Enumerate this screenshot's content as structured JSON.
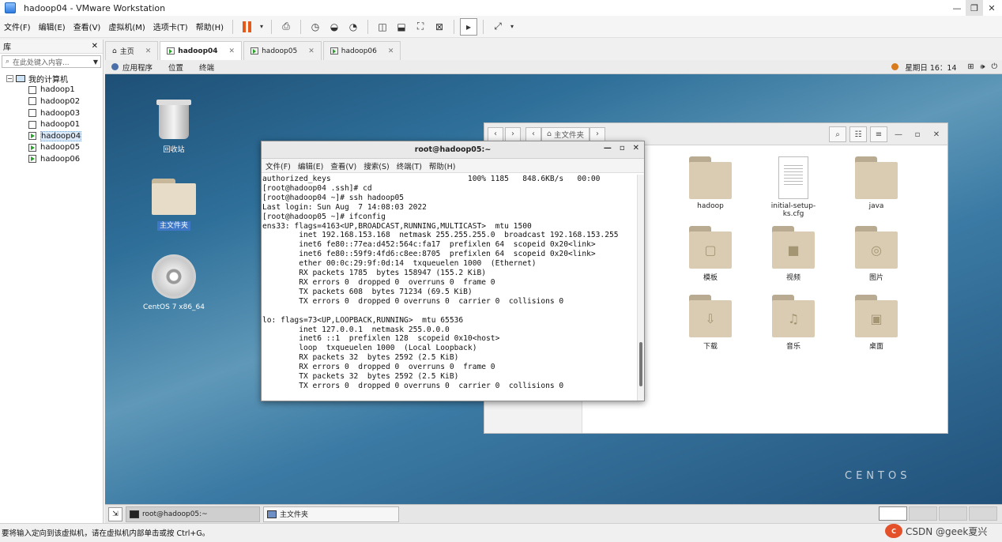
{
  "window": {
    "title": "hadoop04 - VMware Workstation",
    "min": "—",
    "max": "❐",
    "close": "✕"
  },
  "menu": {
    "items": [
      "文件(F)",
      "编辑(E)",
      "查看(V)",
      "虚拟机(M)",
      "选项卡(T)",
      "帮助(H)"
    ]
  },
  "library": {
    "title": "库",
    "close": "✕",
    "search_placeholder": "在此处键入内容...",
    "root": "我的计算机",
    "vms": [
      {
        "name": "hadoop1",
        "running": false
      },
      {
        "name": "hadoop02",
        "running": false
      },
      {
        "name": "hadoop03",
        "running": false
      },
      {
        "name": "hadoop01",
        "running": false
      },
      {
        "name": "hadoop04",
        "running": true,
        "selected": true
      },
      {
        "name": "hadoop05",
        "running": true
      },
      {
        "name": "hadoop06",
        "running": true
      }
    ]
  },
  "tabs": [
    {
      "label": "主页",
      "active": false
    },
    {
      "label": "hadoop04",
      "active": true
    },
    {
      "label": "hadoop05",
      "active": false
    },
    {
      "label": "hadoop06",
      "active": false
    }
  ],
  "guest": {
    "topbar": {
      "apps": "应用程序",
      "places": "位置",
      "terminal": "终端",
      "clock": "星期日 16：14"
    },
    "desktop": {
      "trash": "回收站",
      "home": "主文件夹",
      "disc": "CentOS 7 x86_64",
      "brand": "CENTOS"
    },
    "filemanager": {
      "path": "主文件夹",
      "items": [
        {
          "name": "cfg",
          "kind": "partial"
        },
        {
          "name": "hadoop",
          "kind": "folder",
          "glyph": ""
        },
        {
          "name": "initial-setup-ks.cfg",
          "kind": "doc"
        },
        {
          "name": "java",
          "kind": "folder",
          "glyph": ""
        },
        {
          "name": "模板",
          "kind": "folder",
          "glyph": "▢"
        },
        {
          "name": "视频",
          "kind": "folder",
          "glyph": "■"
        },
        {
          "name": "图片",
          "kind": "folder",
          "glyph": "◎"
        },
        {
          "name": "下载",
          "kind": "folder",
          "glyph": "⇩"
        },
        {
          "name": "音乐",
          "kind": "folder",
          "glyph": "♫"
        },
        {
          "name": "桌面",
          "kind": "folder",
          "glyph": "▣"
        }
      ]
    },
    "terminal": {
      "title": "root@hadoop05:~",
      "menu": [
        "文件(F)",
        "编辑(E)",
        "查看(V)",
        "搜索(S)",
        "终端(T)",
        "帮助(H)"
      ],
      "lines": [
        "authorized_keys                              100% 1185   848.6KB/s   00:00",
        "[root@hadoop04 .ssh]# cd",
        "[root@hadoop04 ~]# ssh hadoop05",
        "Last login: Sun Aug  7 14:08:03 2022",
        "[root@hadoop05 ~]# ifconfig",
        "ens33: flags=4163<UP,BROADCAST,RUNNING,MULTICAST>  mtu 1500",
        "        inet 192.168.153.168  netmask 255.255.255.0  broadcast 192.168.153.255",
        "        inet6 fe80::77ea:d452:564c:fa17  prefixlen 64  scopeid 0x20<link>",
        "        inet6 fe80::59f9:4fd6:c8ee:8705  prefixlen 64  scopeid 0x20<link>",
        "        ether 00:0c:29:9f:0d:14  txqueuelen 1000  (Ethernet)",
        "        RX packets 1785  bytes 158947 (155.2 KiB)",
        "        RX errors 0  dropped 0  overruns 0  frame 0",
        "        TX packets 608  bytes 71234 (69.5 KiB)",
        "        TX errors 0  dropped 0 overruns 0  carrier 0  collisions 0",
        "",
        "lo: flags=73<UP,LOOPBACK,RUNNING>  mtu 65536",
        "        inet 127.0.0.1  netmask 255.0.0.0",
        "        inet6 ::1  prefixlen 128  scopeid 0x10<host>",
        "        loop  txqueuelen 1000  (Local Loopback)",
        "        RX packets 32  bytes 2592 (2.5 KiB)",
        "        RX errors 0  dropped 0  overruns 0  frame 0",
        "        TX packets 32  bytes 2592 (2.5 KiB)",
        "        TX errors 0  dropped 0 overruns 0  carrier 0  collisions 0"
      ]
    },
    "taskbar": {
      "item1": "root@hadoop05:~",
      "item2": "主文件夹"
    }
  },
  "statusbar": {
    "message": "要将输入定向到该虚拟机，请在虚拟机内部单击或按 Ctrl+G。",
    "watermark": "CSDN @geek夏兴"
  },
  "colors": {
    "accent": "#3d77c5",
    "pause": "#e35a1a",
    "desktop": "#2e6f99"
  }
}
